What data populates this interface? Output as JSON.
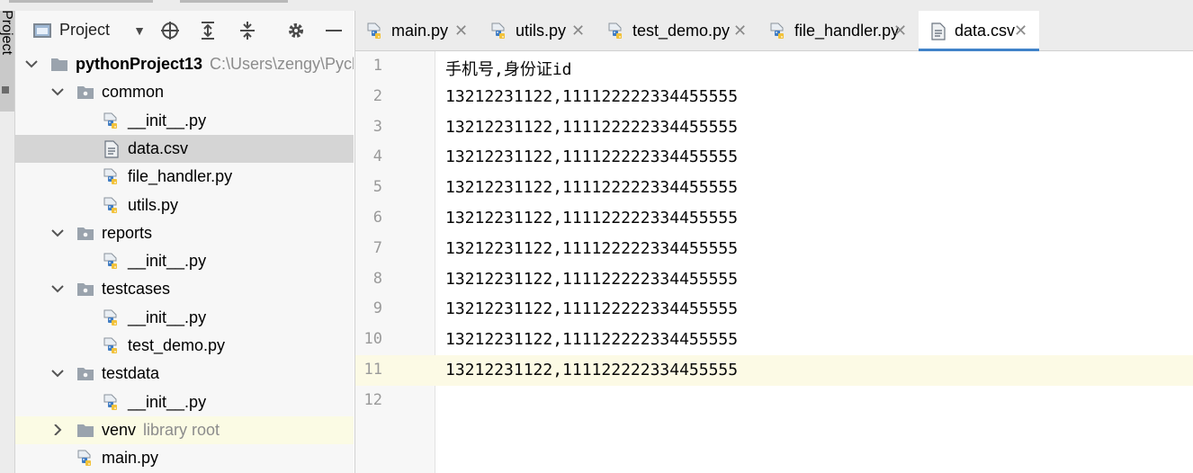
{
  "project_panel": {
    "title": "Project",
    "tree": [
      {
        "name": "pythonProject13",
        "hint": "C:\\Users\\zengy\\Pych",
        "kind": "folder",
        "depth": 0,
        "expanded": true,
        "bold": true
      },
      {
        "name": "common",
        "kind": "package",
        "depth": 1,
        "expanded": true
      },
      {
        "name": "__init__.py",
        "kind": "python",
        "depth": 2
      },
      {
        "name": "data.csv",
        "kind": "text",
        "depth": 2,
        "selected": true
      },
      {
        "name": "file_handler.py",
        "kind": "python",
        "depth": 2
      },
      {
        "name": "utils.py",
        "kind": "python",
        "depth": 2
      },
      {
        "name": "reports",
        "kind": "package",
        "depth": 1,
        "expanded": true
      },
      {
        "name": "__init__.py",
        "kind": "python",
        "depth": 2
      },
      {
        "name": "testcases",
        "kind": "package",
        "depth": 1,
        "expanded": true
      },
      {
        "name": "__init__.py",
        "kind": "python",
        "depth": 2
      },
      {
        "name": "test_demo.py",
        "kind": "python",
        "depth": 2
      },
      {
        "name": "testdata",
        "kind": "package",
        "depth": 1,
        "expanded": true
      },
      {
        "name": "__init__.py",
        "kind": "python",
        "depth": 2
      },
      {
        "name": "venv",
        "hint": "library root",
        "kind": "folder",
        "depth": 1,
        "expanded": false,
        "venv": true
      },
      {
        "name": "main.py",
        "kind": "python",
        "depth": 1
      }
    ]
  },
  "side_stripe": {
    "label": "Project"
  },
  "tabs": [
    {
      "label": "main.py",
      "kind": "python",
      "active": false
    },
    {
      "label": "utils.py",
      "kind": "python",
      "active": false
    },
    {
      "label": "test_demo.py",
      "kind": "python",
      "active": false
    },
    {
      "label": "file_handler.py",
      "kind": "python",
      "active": false
    },
    {
      "label": "data.csv",
      "kind": "text",
      "active": true
    }
  ],
  "editor": {
    "current_line": 11,
    "lines": [
      "手机号,身份证id",
      "13212231122,111122222334455555",
      "13212231122,111122222334455555",
      "13212231122,111122222334455555",
      "13212231122,111122222334455555",
      "13212231122,111122222334455555",
      "13212231122,111122222334455555",
      "13212231122,111122222334455555",
      "13212231122,111122222334455555",
      "13212231122,111122222334455555",
      "13212231122,111122222334455555",
      ""
    ]
  },
  "colors": {
    "accent": "#4083c9",
    "selection": "#d5d5d5",
    "current_line": "#fcfae5",
    "library_root": "#fbfbe4"
  }
}
